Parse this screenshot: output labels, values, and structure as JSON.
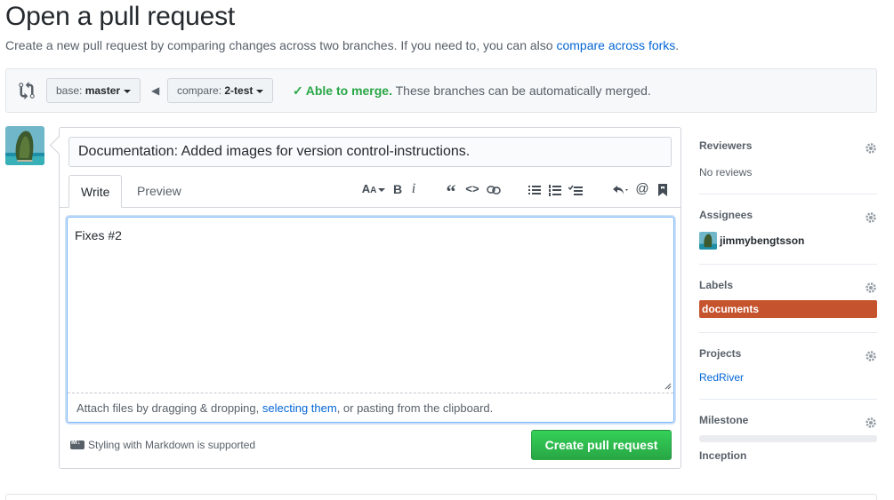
{
  "header": {
    "title": "Open a pull request",
    "subtitle_prefix": "Create a new pull request by comparing changes across two branches. If you need to, you can also ",
    "subtitle_link": "compare across forks",
    "subtitle_suffix": "."
  },
  "range": {
    "base_prefix": "base: ",
    "base_branch": "master",
    "compare_prefix": "compare: ",
    "compare_branch": "2-test",
    "merge_status": "Able to merge.",
    "merge_detail": " These branches can be automatically merged."
  },
  "form": {
    "title_value": "Documentation: Added images for version control-instructions.",
    "tabs": [
      {
        "label": "Write"
      },
      {
        "label": "Preview"
      }
    ],
    "body_value": "Fixes #2",
    "attach_prefix": "Attach files by dragging & dropping, ",
    "attach_link": "selecting them",
    "attach_suffix": ", or pasting from the clipboard.",
    "markdown_note": "Styling with Markdown is supported",
    "submit_label": "Create pull request",
    "toolbar_icons": [
      "text-size-icon",
      "bold-icon",
      "italic-icon",
      "quote-icon",
      "code-icon",
      "link-icon",
      "bulleted-list-icon",
      "numbered-list-icon",
      "task-list-icon",
      "reply-icon",
      "mention-icon",
      "bookmark-icon"
    ]
  },
  "sidebar": {
    "reviewers": {
      "heading": "Reviewers",
      "value": "No reviews"
    },
    "assignees": {
      "heading": "Assignees",
      "user": "jimmybengtsson"
    },
    "labels": {
      "heading": "Labels",
      "label": "documents",
      "label_color": "#c5532d"
    },
    "projects": {
      "heading": "Projects",
      "value": "RedRiver"
    },
    "milestone": {
      "heading": "Milestone",
      "value": "Inception",
      "progress": 0
    }
  },
  "colors": {
    "accent_green": "#28a745",
    "link_blue": "#0366d6"
  }
}
